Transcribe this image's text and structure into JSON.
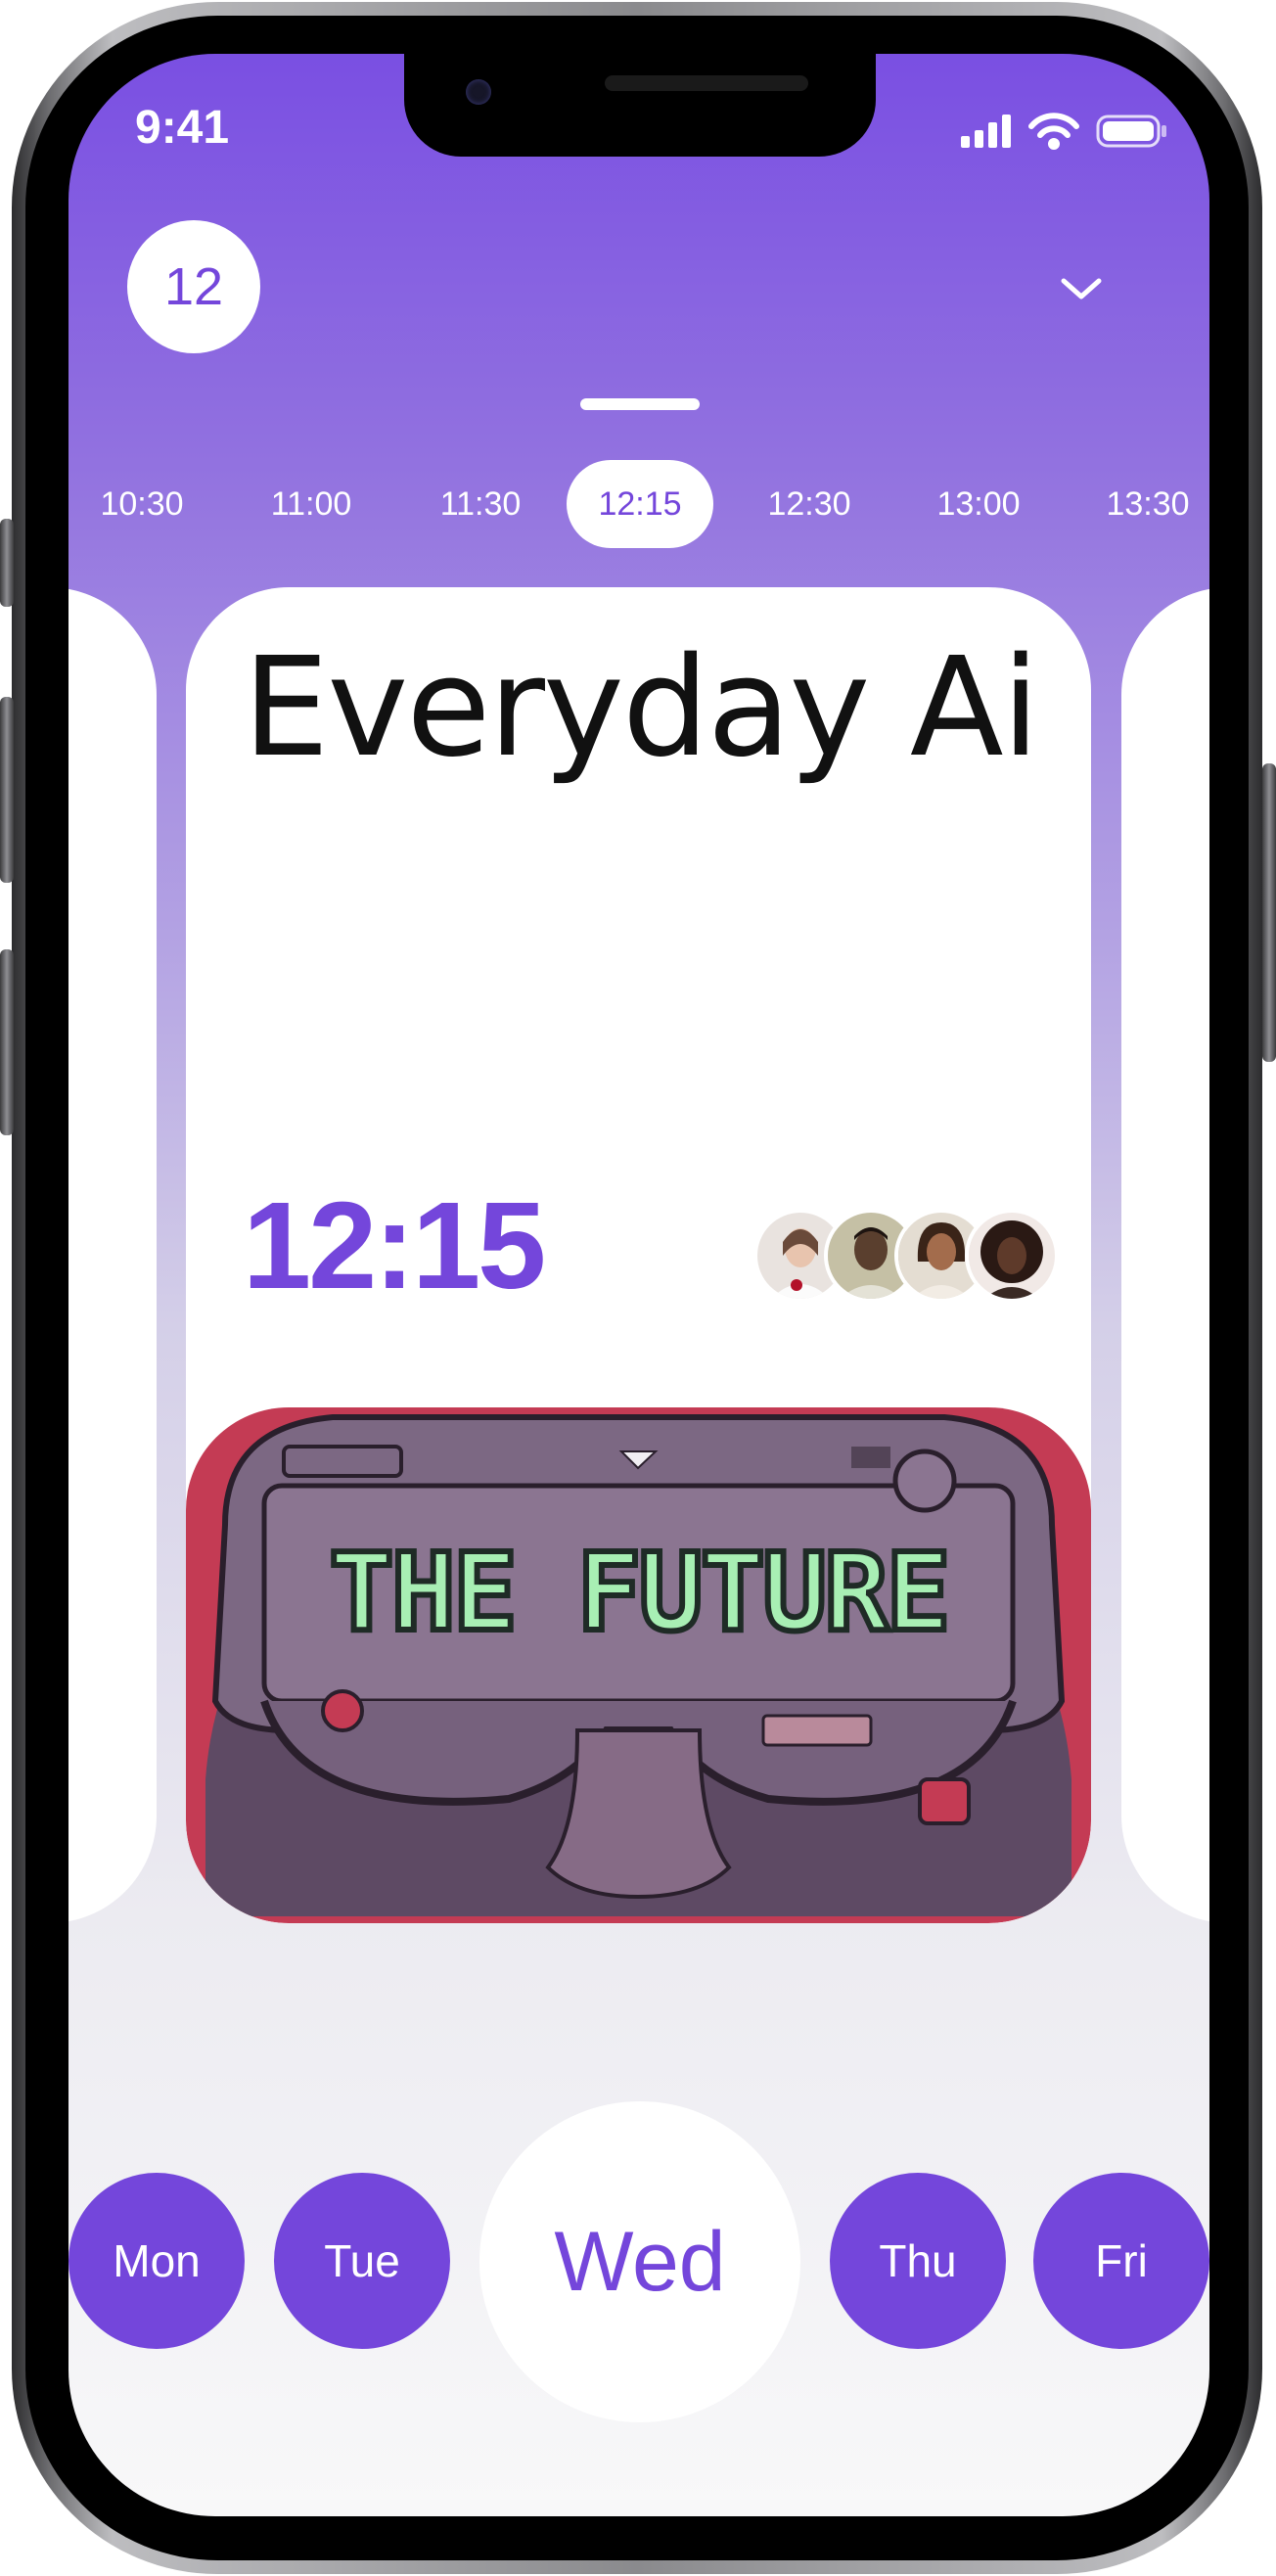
{
  "status_bar": {
    "time": "9:41"
  },
  "header": {
    "date_number": "12"
  },
  "time_slots": [
    "10:30",
    "11:00",
    "11:30",
    "12:15",
    "12:30",
    "13:00",
    "13:30"
  ],
  "selected_time_index": 3,
  "event": {
    "title": "Everyday Ai",
    "time": "12:15",
    "attendee_count": 4,
    "poster_text": "THE FUTURE"
  },
  "days": [
    "Mon",
    "Tue",
    "Wed",
    "Thu",
    "Fri"
  ],
  "selected_day_index": 2,
  "colors": {
    "accent": "#7446db",
    "background_top": "#7a4fe2",
    "poster_red": "#c43b54",
    "poster_text": "#a8efb4"
  },
  "icons": [
    "signal-icon",
    "wifi-icon",
    "battery-icon",
    "chevron-down-icon"
  ]
}
